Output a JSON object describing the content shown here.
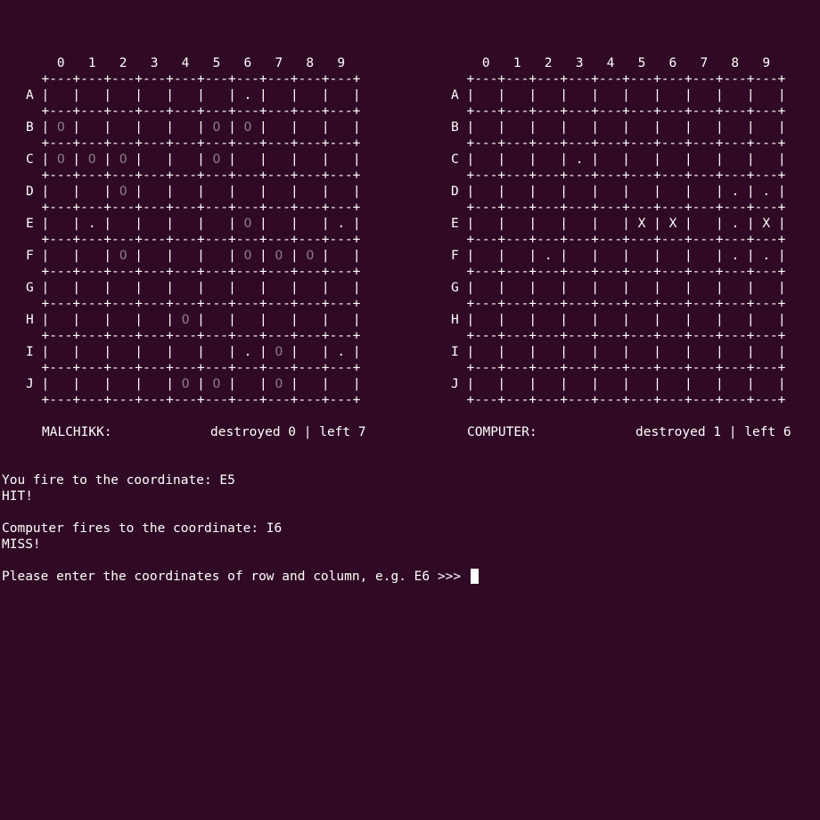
{
  "colors": {
    "background": "#300a24",
    "text": "#ffffff",
    "ship": "#8a7a85"
  },
  "boards": [
    {
      "id": "player",
      "column_labels": [
        "0",
        "1",
        "2",
        "3",
        "4",
        "5",
        "6",
        "7",
        "8",
        "9"
      ],
      "row_labels": [
        "A",
        "B",
        "C",
        "D",
        "E",
        "F",
        "G",
        "H",
        "I",
        "J"
      ],
      "cells": [
        [
          " ",
          " ",
          " ",
          " ",
          " ",
          " ",
          ".",
          " ",
          " ",
          " "
        ],
        [
          "O",
          " ",
          " ",
          " ",
          " ",
          "O",
          "O",
          " ",
          " ",
          " "
        ],
        [
          "O",
          "O",
          "O",
          " ",
          " ",
          "O",
          " ",
          " ",
          " ",
          " "
        ],
        [
          " ",
          " ",
          "O",
          " ",
          " ",
          " ",
          " ",
          " ",
          " ",
          " "
        ],
        [
          " ",
          ".",
          " ",
          " ",
          " ",
          " ",
          "O",
          " ",
          " ",
          "."
        ],
        [
          " ",
          " ",
          "O",
          " ",
          " ",
          " ",
          "O",
          "O",
          "O",
          " "
        ],
        [
          " ",
          " ",
          " ",
          " ",
          " ",
          " ",
          " ",
          " ",
          " ",
          " "
        ],
        [
          " ",
          " ",
          " ",
          " ",
          "O",
          " ",
          " ",
          " ",
          " ",
          " "
        ],
        [
          " ",
          " ",
          " ",
          " ",
          " ",
          " ",
          ".",
          "O",
          " ",
          "."
        ],
        [
          " ",
          " ",
          " ",
          " ",
          "O",
          "O",
          " ",
          "O",
          " ",
          " "
        ]
      ],
      "name": "MALCHIKK:",
      "status": "destroyed 0 | left 7"
    },
    {
      "id": "computer",
      "column_labels": [
        "0",
        "1",
        "2",
        "3",
        "4",
        "5",
        "6",
        "7",
        "8",
        "9"
      ],
      "row_labels": [
        "A",
        "B",
        "C",
        "D",
        "E",
        "F",
        "G",
        "H",
        "I",
        "J"
      ],
      "cells": [
        [
          " ",
          " ",
          " ",
          " ",
          " ",
          " ",
          " ",
          " ",
          " ",
          " "
        ],
        [
          " ",
          " ",
          " ",
          " ",
          " ",
          " ",
          " ",
          " ",
          " ",
          " "
        ],
        [
          " ",
          " ",
          " ",
          ".",
          " ",
          " ",
          " ",
          " ",
          " ",
          " "
        ],
        [
          " ",
          " ",
          " ",
          " ",
          " ",
          " ",
          " ",
          " ",
          ".",
          "."
        ],
        [
          " ",
          " ",
          " ",
          " ",
          " ",
          "X",
          "X",
          " ",
          ".",
          "X"
        ],
        [
          " ",
          " ",
          ".",
          " ",
          " ",
          " ",
          " ",
          " ",
          ".",
          "."
        ],
        [
          " ",
          " ",
          " ",
          " ",
          " ",
          " ",
          " ",
          " ",
          " ",
          " "
        ],
        [
          " ",
          " ",
          " ",
          " ",
          " ",
          " ",
          " ",
          " ",
          " ",
          " "
        ],
        [
          " ",
          " ",
          " ",
          " ",
          " ",
          " ",
          " ",
          " ",
          " ",
          " "
        ],
        [
          " ",
          " ",
          " ",
          " ",
          " ",
          " ",
          " ",
          " ",
          " ",
          " "
        ]
      ],
      "name": "COMPUTER:",
      "status": "destroyed 1 | left 6"
    }
  ],
  "log": {
    "player_fire": "You fire to the coordinate: E5",
    "player_result": "HIT!",
    "computer_fire": "Computer fires to the coordinate: I6",
    "computer_result": "MISS!",
    "prompt": "Please enter the coordinates of row and column, e.g. E6 >>> "
  }
}
